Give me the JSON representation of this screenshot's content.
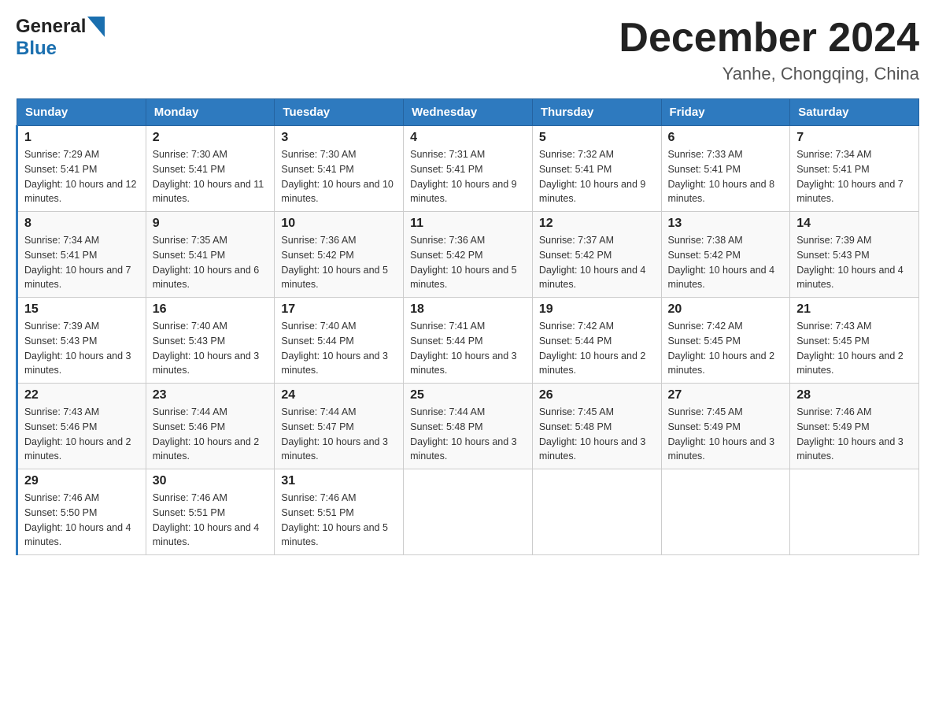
{
  "logo": {
    "text_general": "General",
    "text_blue": "Blue",
    "arrow_desc": "blue arrow logo"
  },
  "title": "December 2024",
  "subtitle": "Yanhe, Chongqing, China",
  "headers": [
    "Sunday",
    "Monday",
    "Tuesday",
    "Wednesday",
    "Thursday",
    "Friday",
    "Saturday"
  ],
  "weeks": [
    [
      {
        "day": "1",
        "sunrise": "7:29 AM",
        "sunset": "5:41 PM",
        "daylight": "10 hours and 12 minutes."
      },
      {
        "day": "2",
        "sunrise": "7:30 AM",
        "sunset": "5:41 PM",
        "daylight": "10 hours and 11 minutes."
      },
      {
        "day": "3",
        "sunrise": "7:30 AM",
        "sunset": "5:41 PM",
        "daylight": "10 hours and 10 minutes."
      },
      {
        "day": "4",
        "sunrise": "7:31 AM",
        "sunset": "5:41 PM",
        "daylight": "10 hours and 9 minutes."
      },
      {
        "day": "5",
        "sunrise": "7:32 AM",
        "sunset": "5:41 PM",
        "daylight": "10 hours and 9 minutes."
      },
      {
        "day": "6",
        "sunrise": "7:33 AM",
        "sunset": "5:41 PM",
        "daylight": "10 hours and 8 minutes."
      },
      {
        "day": "7",
        "sunrise": "7:34 AM",
        "sunset": "5:41 PM",
        "daylight": "10 hours and 7 minutes."
      }
    ],
    [
      {
        "day": "8",
        "sunrise": "7:34 AM",
        "sunset": "5:41 PM",
        "daylight": "10 hours and 7 minutes."
      },
      {
        "day": "9",
        "sunrise": "7:35 AM",
        "sunset": "5:41 PM",
        "daylight": "10 hours and 6 minutes."
      },
      {
        "day": "10",
        "sunrise": "7:36 AM",
        "sunset": "5:42 PM",
        "daylight": "10 hours and 5 minutes."
      },
      {
        "day": "11",
        "sunrise": "7:36 AM",
        "sunset": "5:42 PM",
        "daylight": "10 hours and 5 minutes."
      },
      {
        "day": "12",
        "sunrise": "7:37 AM",
        "sunset": "5:42 PM",
        "daylight": "10 hours and 4 minutes."
      },
      {
        "day": "13",
        "sunrise": "7:38 AM",
        "sunset": "5:42 PM",
        "daylight": "10 hours and 4 minutes."
      },
      {
        "day": "14",
        "sunrise": "7:39 AM",
        "sunset": "5:43 PM",
        "daylight": "10 hours and 4 minutes."
      }
    ],
    [
      {
        "day": "15",
        "sunrise": "7:39 AM",
        "sunset": "5:43 PM",
        "daylight": "10 hours and 3 minutes."
      },
      {
        "day": "16",
        "sunrise": "7:40 AM",
        "sunset": "5:43 PM",
        "daylight": "10 hours and 3 minutes."
      },
      {
        "day": "17",
        "sunrise": "7:40 AM",
        "sunset": "5:44 PM",
        "daylight": "10 hours and 3 minutes."
      },
      {
        "day": "18",
        "sunrise": "7:41 AM",
        "sunset": "5:44 PM",
        "daylight": "10 hours and 3 minutes."
      },
      {
        "day": "19",
        "sunrise": "7:42 AM",
        "sunset": "5:44 PM",
        "daylight": "10 hours and 2 minutes."
      },
      {
        "day": "20",
        "sunrise": "7:42 AM",
        "sunset": "5:45 PM",
        "daylight": "10 hours and 2 minutes."
      },
      {
        "day": "21",
        "sunrise": "7:43 AM",
        "sunset": "5:45 PM",
        "daylight": "10 hours and 2 minutes."
      }
    ],
    [
      {
        "day": "22",
        "sunrise": "7:43 AM",
        "sunset": "5:46 PM",
        "daylight": "10 hours and 2 minutes."
      },
      {
        "day": "23",
        "sunrise": "7:44 AM",
        "sunset": "5:46 PM",
        "daylight": "10 hours and 2 minutes."
      },
      {
        "day": "24",
        "sunrise": "7:44 AM",
        "sunset": "5:47 PM",
        "daylight": "10 hours and 3 minutes."
      },
      {
        "day": "25",
        "sunrise": "7:44 AM",
        "sunset": "5:48 PM",
        "daylight": "10 hours and 3 minutes."
      },
      {
        "day": "26",
        "sunrise": "7:45 AM",
        "sunset": "5:48 PM",
        "daylight": "10 hours and 3 minutes."
      },
      {
        "day": "27",
        "sunrise": "7:45 AM",
        "sunset": "5:49 PM",
        "daylight": "10 hours and 3 minutes."
      },
      {
        "day": "28",
        "sunrise": "7:46 AM",
        "sunset": "5:49 PM",
        "daylight": "10 hours and 3 minutes."
      }
    ],
    [
      {
        "day": "29",
        "sunrise": "7:46 AM",
        "sunset": "5:50 PM",
        "daylight": "10 hours and 4 minutes."
      },
      {
        "day": "30",
        "sunrise": "7:46 AM",
        "sunset": "5:51 PM",
        "daylight": "10 hours and 4 minutes."
      },
      {
        "day": "31",
        "sunrise": "7:46 AM",
        "sunset": "5:51 PM",
        "daylight": "10 hours and 5 minutes."
      },
      null,
      null,
      null,
      null
    ]
  ]
}
